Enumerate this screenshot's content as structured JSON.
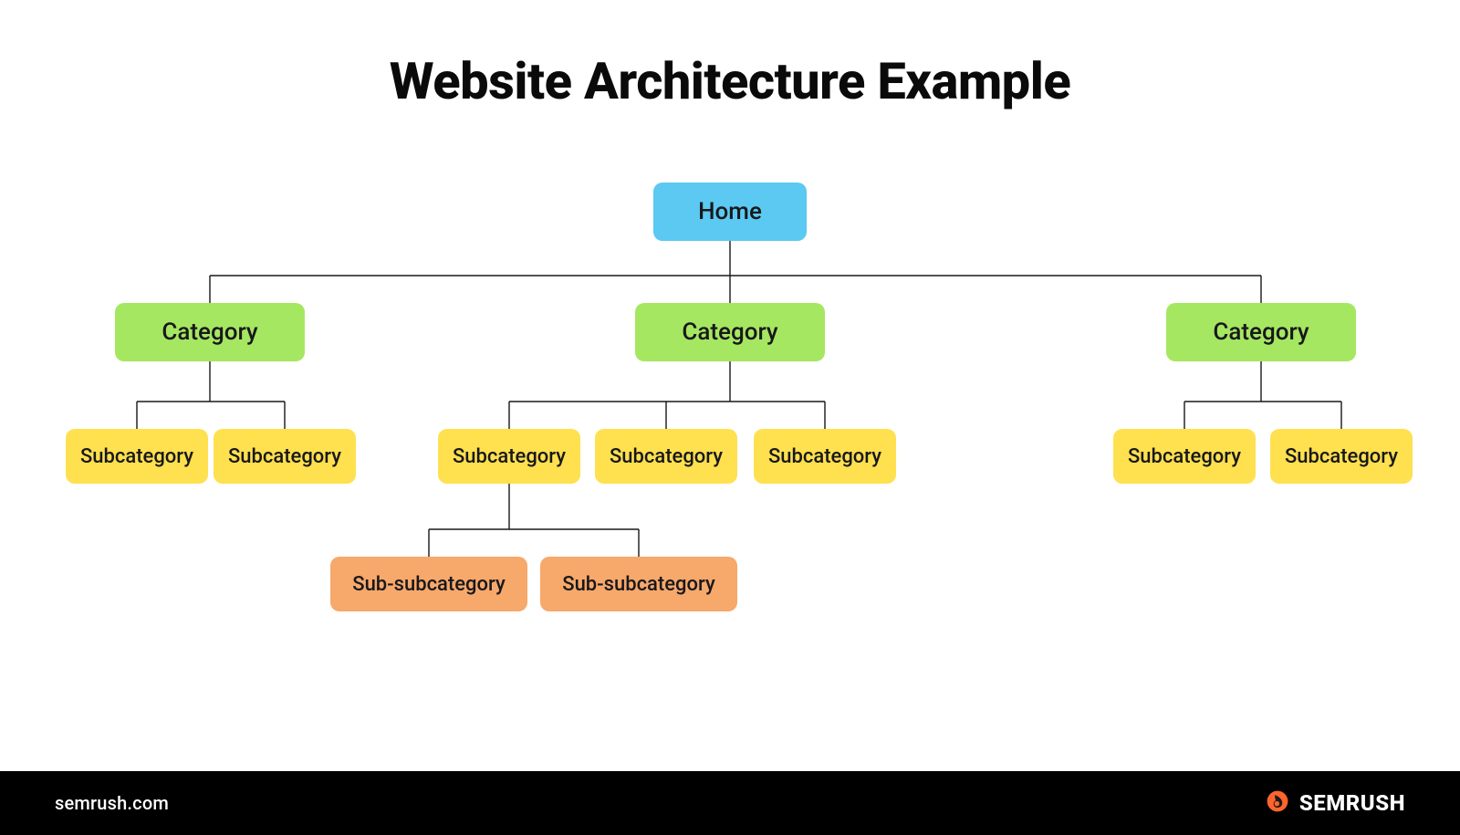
{
  "title": "Website Architecture Example",
  "footer": {
    "url": "semrush.com",
    "brand": "SEMRUSH"
  },
  "colors": {
    "home": "#5bc9f2",
    "category": "#a6e762",
    "subcategory": "#ffe04f",
    "subsub": "#f7a86b"
  },
  "nodes": {
    "home": "Home",
    "cat1": "Category",
    "cat2": "Category",
    "cat3": "Category",
    "sub11": "Subcategory",
    "sub12": "Subcategory",
    "sub21": "Subcategory",
    "sub22": "Subcategory",
    "sub23": "Subcategory",
    "sub31": "Subcategory",
    "sub32": "Subcategory",
    "ss1": "Sub-subcategory",
    "ss2": "Sub-subcategory"
  }
}
